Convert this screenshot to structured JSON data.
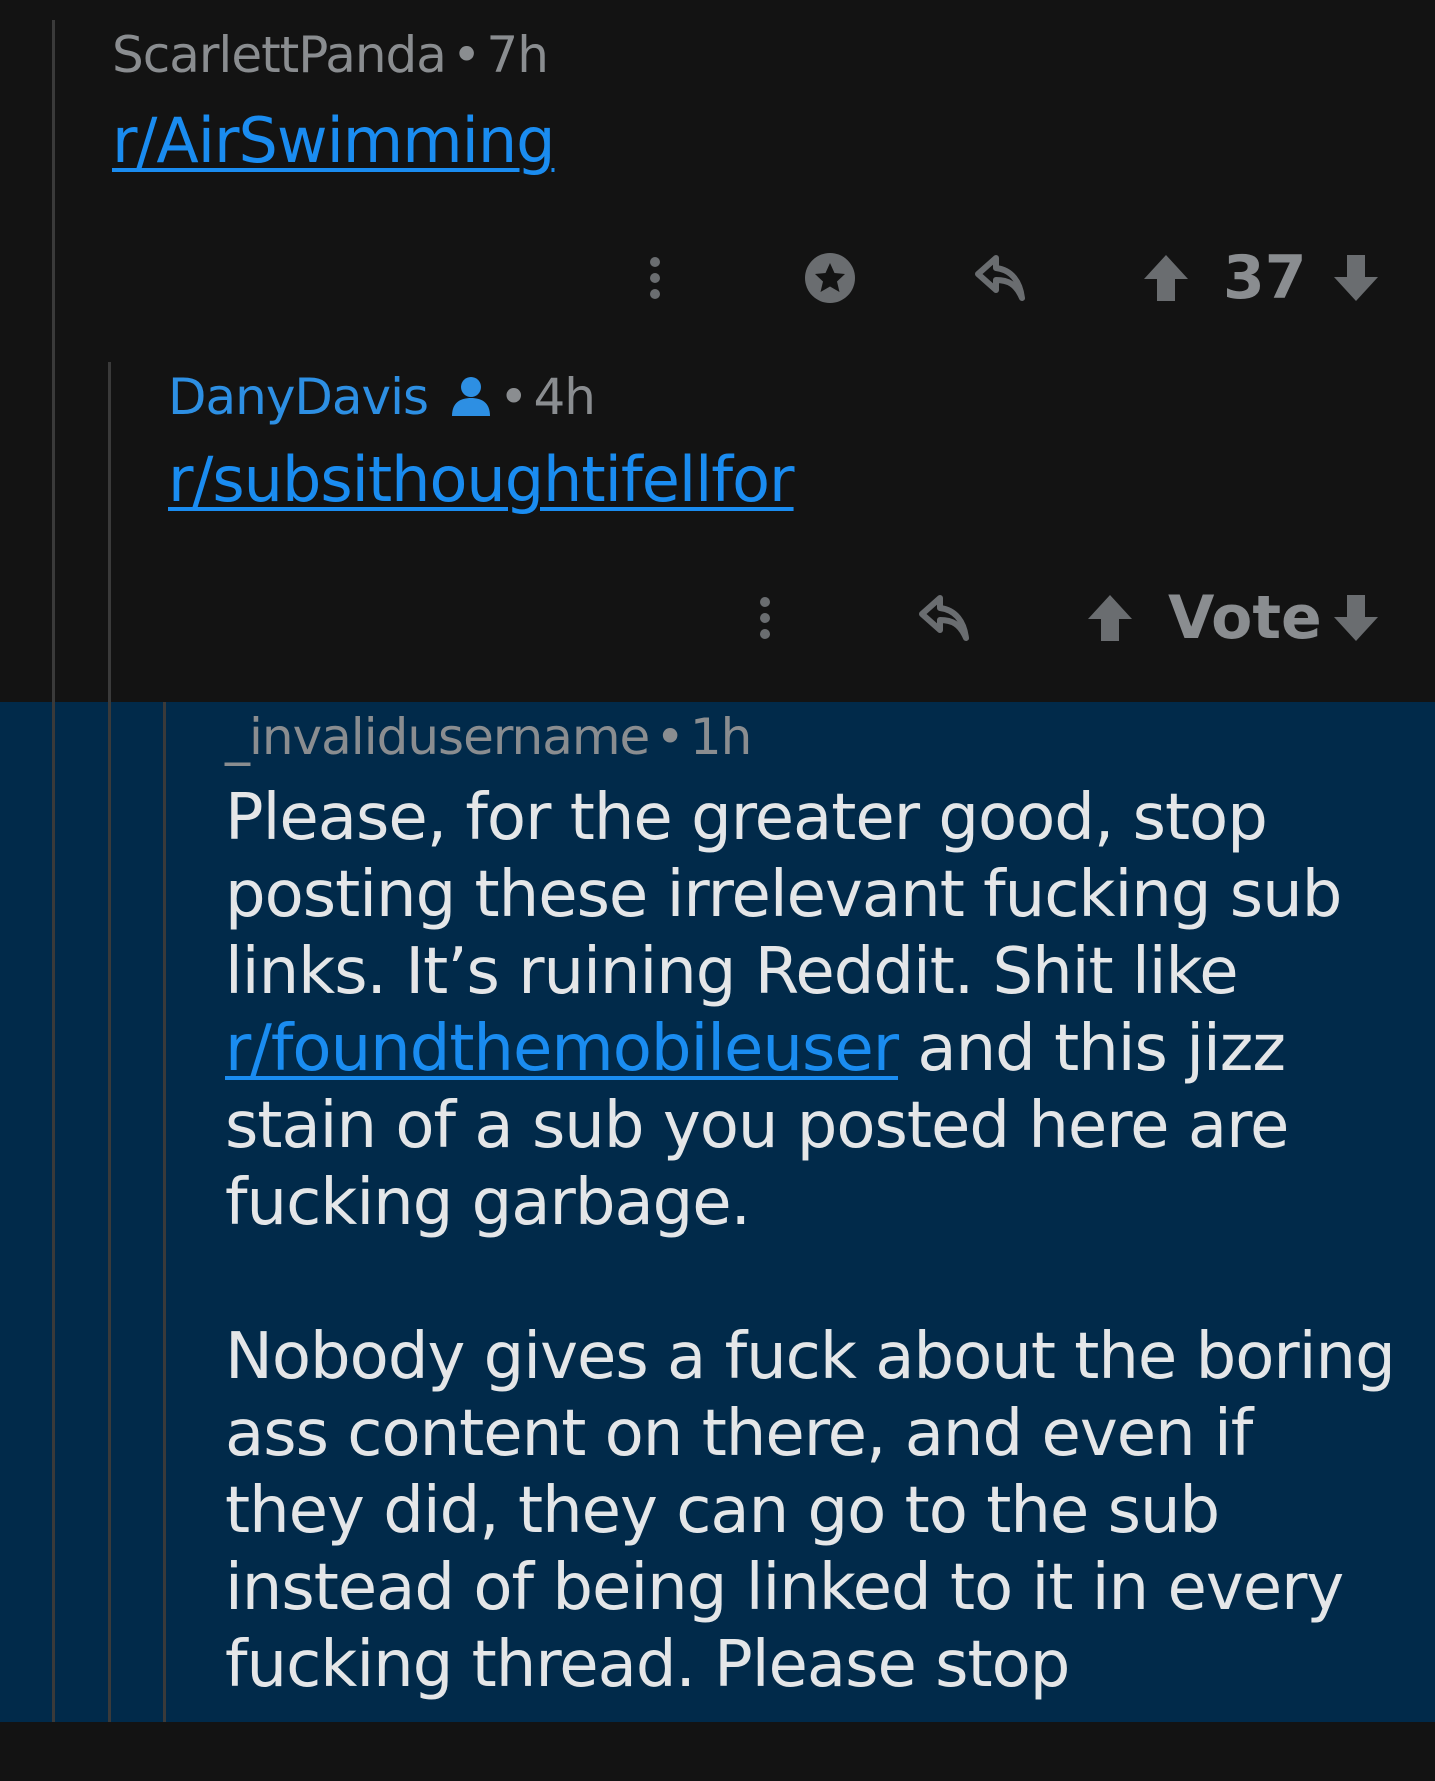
{
  "comments": [
    {
      "author": "ScarlettPanda",
      "time": "7h",
      "body_link": "r/AirSwimming",
      "vote_label": "37"
    },
    {
      "author": "DanyDavis",
      "time": "4h",
      "body_link": "r/subsithoughtifellfor",
      "vote_label": "Vote"
    },
    {
      "author": "_invalidusername",
      "time": "1h",
      "para1_a": "Please, for the greater good, stop posting these irrelevant fucking sub links. It’s ruining Reddit. Shit like ",
      "para1_link": "r/foundthemobileuser",
      "para1_b": " and this jizz stain of a sub you posted here are fucking garbage.",
      "para2": "Nobody gives a fuck about the boring ass content on there, and even if they did, they can go to the sub instead of being linked to it in every fucking thread. Please stop"
    }
  ],
  "separator": "•",
  "icons": {
    "more": "more-vertical-icon",
    "award": "award-icon",
    "reply": "reply-icon",
    "upvote": "upvote-arrow-icon",
    "downvote": "downvote-arrow-icon",
    "op": "op-user-icon"
  },
  "colors": {
    "background": "#131313",
    "highlight": "#012a4a",
    "link": "#1a8cf0",
    "op_author": "#2d8fe3",
    "meta": "#8a8d90"
  }
}
